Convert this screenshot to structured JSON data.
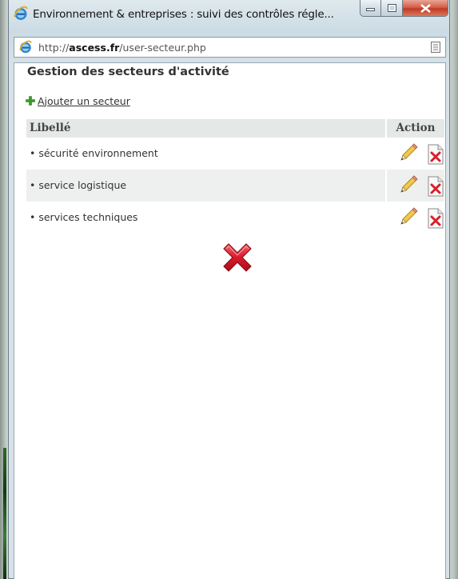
{
  "window": {
    "title": "Environnement & entreprises : suivi des contrôles régle..."
  },
  "address": {
    "prefix": "http://",
    "domain": "ascess.fr",
    "path": "/user-secteur.php"
  },
  "page": {
    "title": "Gestion des secteurs d'activité",
    "add_link": "Ajouter un secteur"
  },
  "table": {
    "columns": [
      "Libellé",
      "Action"
    ],
    "rows": [
      {
        "label": "• sécurité environnement"
      },
      {
        "label": "• service logistique"
      },
      {
        "label": "• services techniques"
      }
    ]
  },
  "icons": {
    "title": "ie-icon",
    "address": "ie-icon",
    "address_right": "page-icon",
    "add": "plus-icon",
    "edit": "pencil-icon",
    "delete": "delete-file-icon",
    "close": "close-x-icon"
  },
  "colors": {
    "plus": "#3c9a2a",
    "delete_x": "#d8202a",
    "close_x": "#d9192b",
    "header_bg": "#e4e8e6",
    "row_alt_bg": "#eef0ef"
  }
}
